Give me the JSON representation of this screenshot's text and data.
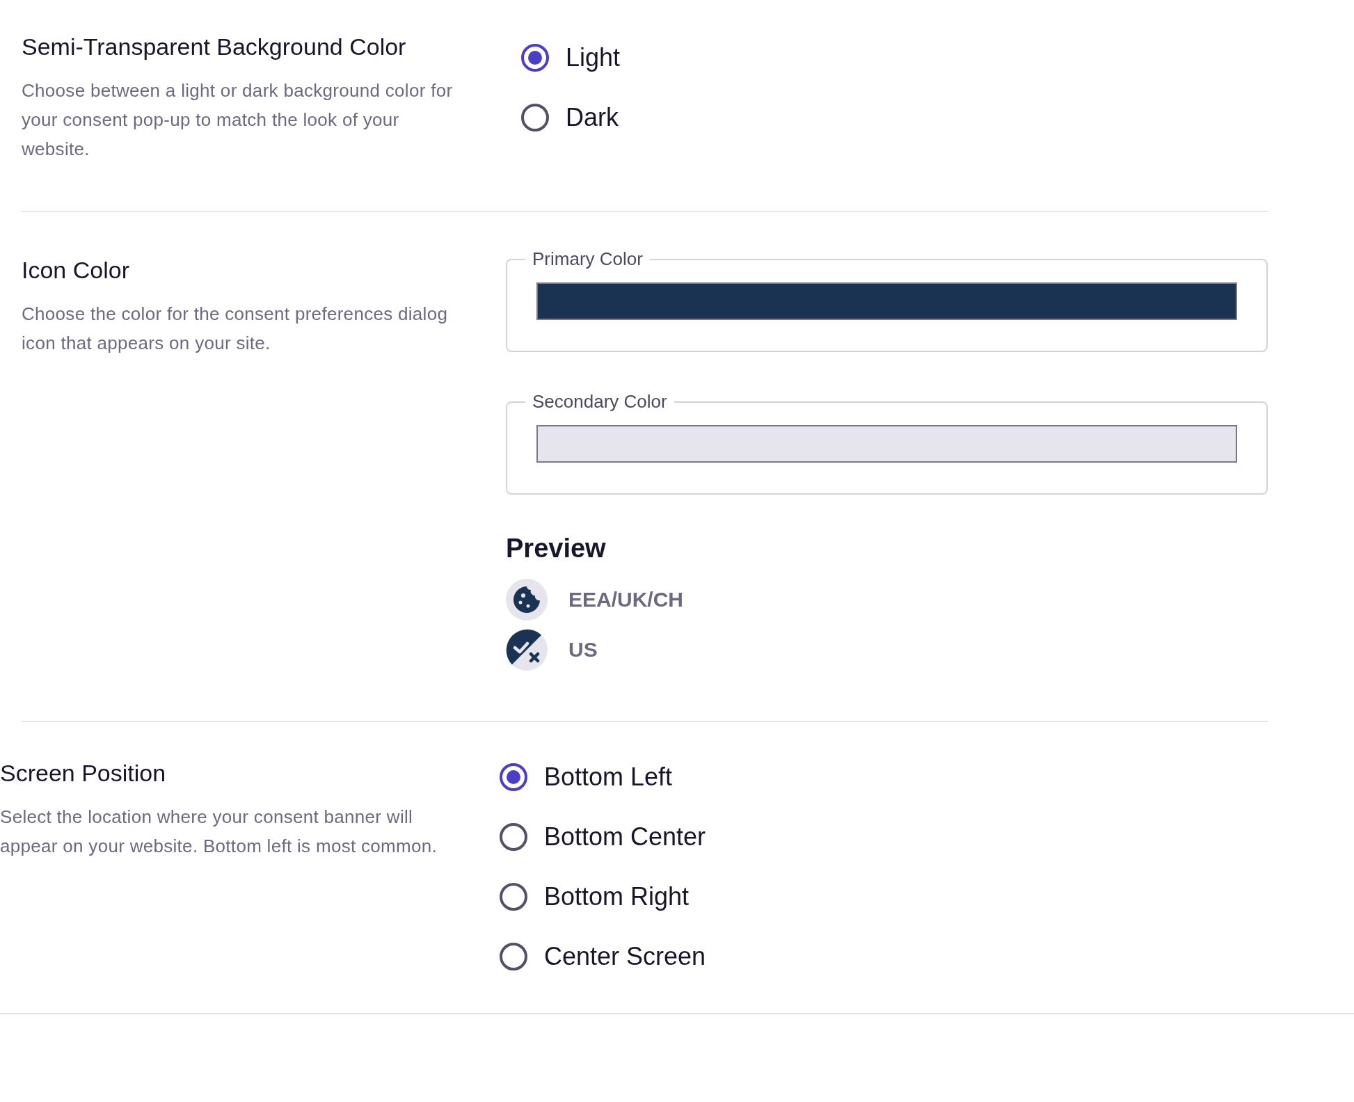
{
  "sections": [
    {
      "kind": "radio",
      "title": "Semi-Transparent Background Color",
      "description": "Choose between a light or dark background color for your consent pop-up to match the look of your website.",
      "options": [
        {
          "label": "Light",
          "selected": true
        },
        {
          "label": "Dark",
          "selected": false
        }
      ]
    },
    {
      "kind": "colors",
      "title": "Icon Color",
      "description": "Choose the color for the consent preferences dialog icon that appears on your site.",
      "fields": [
        {
          "label": "Primary Color",
          "color": "#1b3352"
        },
        {
          "label": "Secondary Color",
          "color": "#e6e5ee"
        }
      ],
      "preview": {
        "title": "Preview",
        "items": [
          {
            "kind": "cookie",
            "label": "EEA/UK/CH"
          },
          {
            "kind": "check",
            "label": "US"
          }
        ]
      }
    },
    {
      "kind": "radio",
      "title": "Screen Position",
      "description": "Select the location where your consent banner will appear on your website. Bottom left is most common.",
      "options": [
        {
          "label": "Bottom Left",
          "selected": true
        },
        {
          "label": "Bottom Center",
          "selected": false
        },
        {
          "label": "Bottom Right",
          "selected": false
        },
        {
          "label": "Center Screen",
          "selected": false
        }
      ]
    }
  ]
}
